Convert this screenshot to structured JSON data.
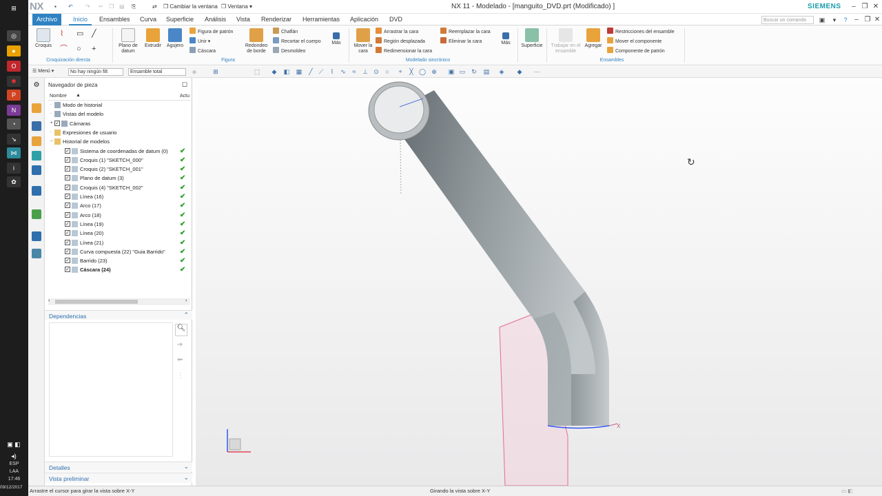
{
  "taskbar": {
    "lang": "ESP",
    "layout": "LAA",
    "time": "17:46",
    "date": "09/12/2017"
  },
  "titlebar": {
    "logo": "NX",
    "switch_window": "Cambiar la ventana",
    "window_menu": "Ventana",
    "title": "NX 11 - Modelado - [manguito_DVD.prt (Modificado) ]",
    "brand": "SIEMENS"
  },
  "menubar": {
    "tabs": [
      "Archivo",
      "Inicio",
      "Ensambles",
      "Curva",
      "Superficie",
      "Análisis",
      "Vista",
      "Renderizar",
      "Herramientas",
      "Aplicación",
      "DVD"
    ],
    "search_placeholder": "Buscar un comando"
  },
  "ribbon": {
    "croquis": "Croquis",
    "plano_datum": "Plano de datum",
    "extrudir": "Extrudir",
    "agujero": "Agujero",
    "figura_patron": "Figura de patrón",
    "unir": "Unir",
    "cascara": "Cáscara",
    "redondeo_borde": "Redondeo de borde",
    "chaflan": "Chaflán",
    "recortar_cuerpo": "Recortar el cuerpo",
    "desmoldeo": "Desmoldeo",
    "mas1": "Más",
    "mover_cara": "Mover la cara",
    "arrastrar_cara": "Arrastrar la cara",
    "region_desplazada": "Región desplazada",
    "redimensionar_cara": "Redimensionar la cara",
    "reemplazar_cara": "Reemplazar la cara",
    "eliminar_cara": "Eliminar la cara",
    "mas2": "Más",
    "superficie": "Superficie",
    "trabajar_ensamble": "Trabajar en el ensamble",
    "agregar": "Agregar",
    "restricciones_ensamble": "Restricciones del ensamble",
    "mover_componente": "Mover el componente",
    "componente_patron": "Componente de patrón",
    "groups": {
      "croquizacion": "Croquización directa",
      "figura": "Figura",
      "modelado_sincronico": "Modelado sincrónico",
      "ensambles": "Ensambles"
    }
  },
  "toolbar": {
    "menu": "Menú",
    "filter": "No hay ningún filt",
    "assembly": "Ensamble total"
  },
  "navigator": {
    "title": "Navegador de pieza",
    "col_name": "Nombre",
    "col_updated": "Actu",
    "items": [
      {
        "label": "Modo de historial",
        "indent": 0,
        "check": false,
        "ok": false,
        "bold": false
      },
      {
        "label": "Vistas del modelo",
        "indent": 0,
        "check": false,
        "ok": false,
        "bold": false
      },
      {
        "label": "Cámaras",
        "indent": 0,
        "check": true,
        "ok": false,
        "bold": false
      },
      {
        "label": "Expresiones de usuario",
        "indent": 0,
        "check": false,
        "ok": false,
        "bold": false
      },
      {
        "label": "Historial de modelos",
        "indent": 0,
        "check": false,
        "ok": false,
        "bold": false
      },
      {
        "label": "Sistema de coordenadas de datum (0)",
        "indent": 1,
        "check": true,
        "ok": true,
        "bold": false
      },
      {
        "label": "Croquis (1) \"SKETCH_000\"",
        "indent": 1,
        "check": true,
        "ok": true,
        "bold": false
      },
      {
        "label": "Croquis (2) \"SKETCH_001\"",
        "indent": 1,
        "check": true,
        "ok": true,
        "bold": false
      },
      {
        "label": "Plano de datum (3)",
        "indent": 1,
        "check": true,
        "ok": true,
        "bold": false
      },
      {
        "label": "Croquis (4) \"SKETCH_002\"",
        "indent": 1,
        "check": true,
        "ok": true,
        "bold": false
      },
      {
        "label": "Línea (16)",
        "indent": 1,
        "check": true,
        "ok": true,
        "bold": false
      },
      {
        "label": "Arco (17)",
        "indent": 1,
        "check": true,
        "ok": true,
        "bold": false
      },
      {
        "label": "Arco (18)",
        "indent": 1,
        "check": true,
        "ok": true,
        "bold": false
      },
      {
        "label": "Línea (19)",
        "indent": 1,
        "check": true,
        "ok": true,
        "bold": false
      },
      {
        "label": "Línea (20)",
        "indent": 1,
        "check": true,
        "ok": true,
        "bold": false
      },
      {
        "label": "Línea (21)",
        "indent": 1,
        "check": true,
        "ok": true,
        "bold": false
      },
      {
        "label": "Curva compuesta (22) \"Guia Barrido\"",
        "indent": 1,
        "check": true,
        "ok": true,
        "bold": false
      },
      {
        "label": "Barrido (23)",
        "indent": 1,
        "check": true,
        "ok": true,
        "bold": false
      },
      {
        "label": "Cáscara (24)",
        "indent": 1,
        "check": true,
        "ok": true,
        "bold": true
      }
    ],
    "dependencies": "Dependencias",
    "details": "Detalles",
    "preview": "Vista preliminar"
  },
  "status": {
    "left": "Arrastre el cursor para girar la vista sobre X-Y",
    "center": "Girando la vista sobre X-Y"
  },
  "viewport": {
    "axis_label": "X",
    "colors": {
      "pipe": "#8f979b",
      "plane": "#e56a8d",
      "edge": "#3355ee"
    }
  }
}
